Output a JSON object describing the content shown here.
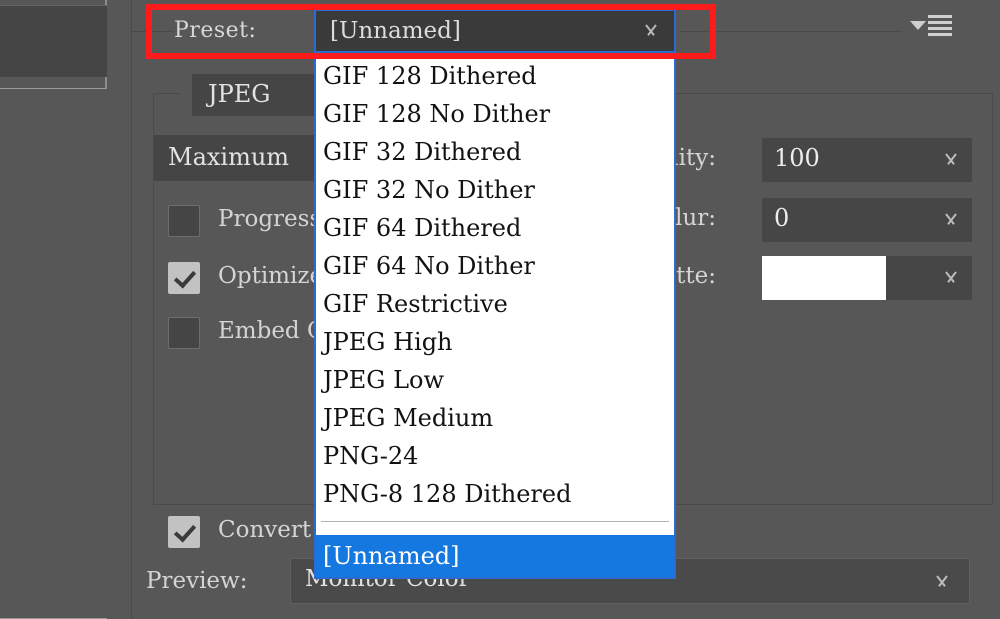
{
  "app": {
    "theme_bg": "#575757",
    "accent_blue": "#1577e0",
    "annotation_red": "#fe1b1b"
  },
  "preset_row": {
    "label": "Preset:",
    "selected_value": "[Unnamed]",
    "caret_icon": "chevron-down-icon",
    "panel_menu_icon": "panel-menu-icon"
  },
  "dropdown": {
    "items": [
      "GIF 128 Dithered",
      "GIF 128 No Dither",
      "GIF 32 Dithered",
      "GIF 32 No Dither",
      "GIF 64 Dithered",
      "GIF 64 No Dither",
      "GIF Restrictive",
      "JPEG High",
      "JPEG Low",
      "JPEG Medium",
      "PNG-24",
      "PNG-8 128 Dithered"
    ],
    "separator_after_index": 11,
    "selected_item": "[Unnamed]"
  },
  "settings": {
    "format": "JPEG",
    "quality_preset": "Maximum",
    "checkboxes": [
      {
        "label": "Progressive",
        "checked": false
      },
      {
        "label": "Optimized",
        "checked": true
      },
      {
        "label": "Embed Color Profile",
        "checked": false
      }
    ],
    "fields": [
      {
        "label": "Quality:",
        "value": "100",
        "type": "number",
        "caret_icon": "chevron-down-icon"
      },
      {
        "label": "Blur:",
        "value": "0",
        "type": "number",
        "caret_icon": "chevron-down-icon"
      },
      {
        "label": "Matte:",
        "value": "",
        "type": "color",
        "swatch_color": "#ffffff",
        "caret_icon": "chevron-down-icon"
      }
    ],
    "convert_checkbox": {
      "label": "Convert to sRGB",
      "checked": true
    }
  },
  "preview_row": {
    "label": "Preview:",
    "value": "Monitor Color",
    "caret_icon": "chevron-down-icon"
  }
}
